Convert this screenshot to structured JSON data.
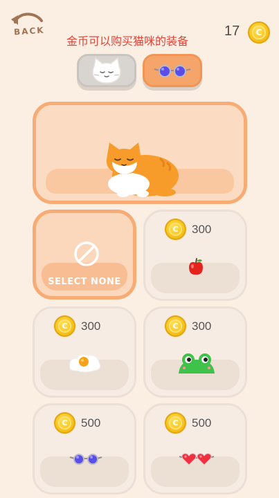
{
  "header": {
    "back_label": "BACK",
    "hint": "金币可以购买猫咪的装备",
    "coins": "17"
  },
  "tabs": [
    {
      "name": "cat",
      "icon": "cat-face-icon",
      "selected": false
    },
    {
      "name": "glasses",
      "icon": "glasses-icon",
      "selected": true
    }
  ],
  "shop": {
    "select_none_label": "SELECT NONE",
    "items": [
      {
        "price": "300",
        "icon": "apple-icon"
      },
      {
        "price": "300",
        "icon": "fried-egg-icon"
      },
      {
        "price": "300",
        "icon": "frog-hat-icon"
      },
      {
        "price": "500",
        "icon": "blue-glasses-icon"
      },
      {
        "price": "500",
        "icon": "heart-glasses-icon"
      }
    ]
  },
  "colors": {
    "background": "#fbeee3",
    "accent": "#f6ac74",
    "hint_text": "#e0453a",
    "coin": "#f7c31b"
  }
}
